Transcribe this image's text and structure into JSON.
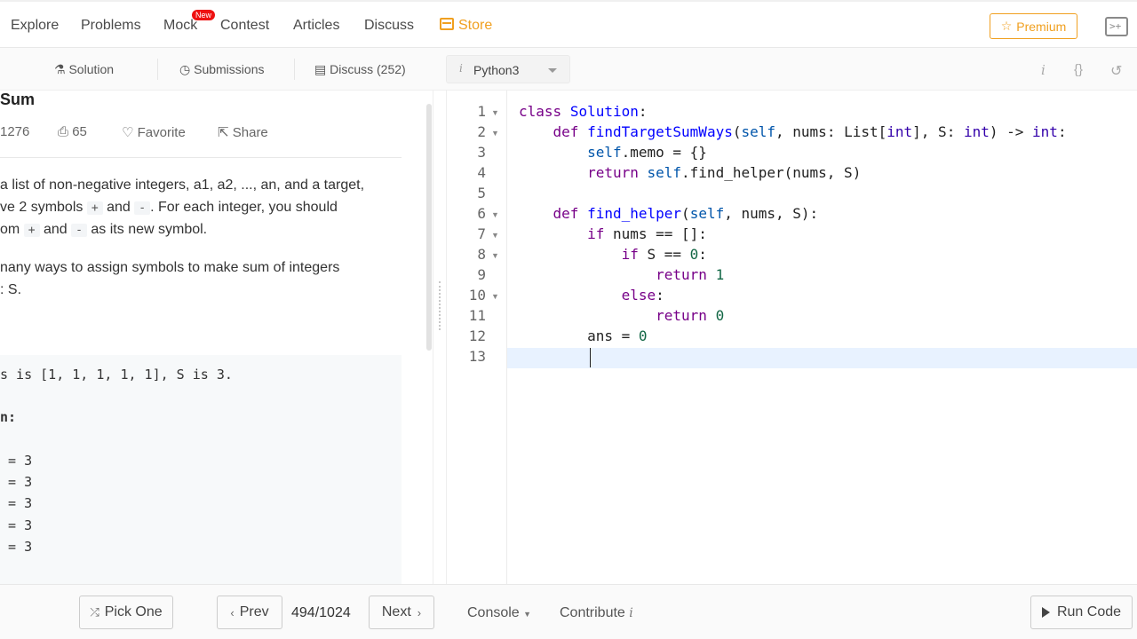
{
  "nav": {
    "items": [
      "Explore",
      "Problems",
      "Mock",
      "Contest",
      "Articles",
      "Discuss"
    ],
    "store_label": "Store",
    "new_badge": "New",
    "premium_label": "Premium",
    "accent_color": "#f0a020"
  },
  "subtabs": {
    "solution": "Solution",
    "submissions": "Submissions",
    "discuss": "Discuss (252)",
    "language": "Python3",
    "info_icon": "i",
    "braces_icon": "{}"
  },
  "problem": {
    "title_partial": "Sum",
    "likes": "1276",
    "dislikes": "65",
    "favorite": "Favorite",
    "share": "Share",
    "lines": [
      "a list of non-negative integers, a1, a2, ..., an, and a target,",
      "ve 2 symbols",
      "and",
      ". For each integer, you should",
      "om",
      "and",
      "as its new symbol.",
      "nany ways to assign symbols to make sum of integers",
      ": S."
    ],
    "plus": "+",
    "minus": "-",
    "example": [
      "s is [1, 1, 1, 1, 1], S is 3.",
      "n:",
      " = 3",
      " = 3",
      " = 3",
      " = 3",
      " = 3"
    ]
  },
  "editor": {
    "line_numbers": [
      "1",
      "2",
      "3",
      "4",
      "5",
      "6",
      "7",
      "8",
      "9",
      "10",
      "11",
      "12",
      "13"
    ],
    "folded_lines": [
      "1",
      "2",
      "6",
      "7",
      "8",
      "10"
    ]
  },
  "bottom": {
    "pick_one": "Pick One",
    "prev": "Prev",
    "page": "494/1024",
    "next": "Next",
    "console": "Console",
    "contribute": "Contribute",
    "run_code": "Run Code"
  }
}
